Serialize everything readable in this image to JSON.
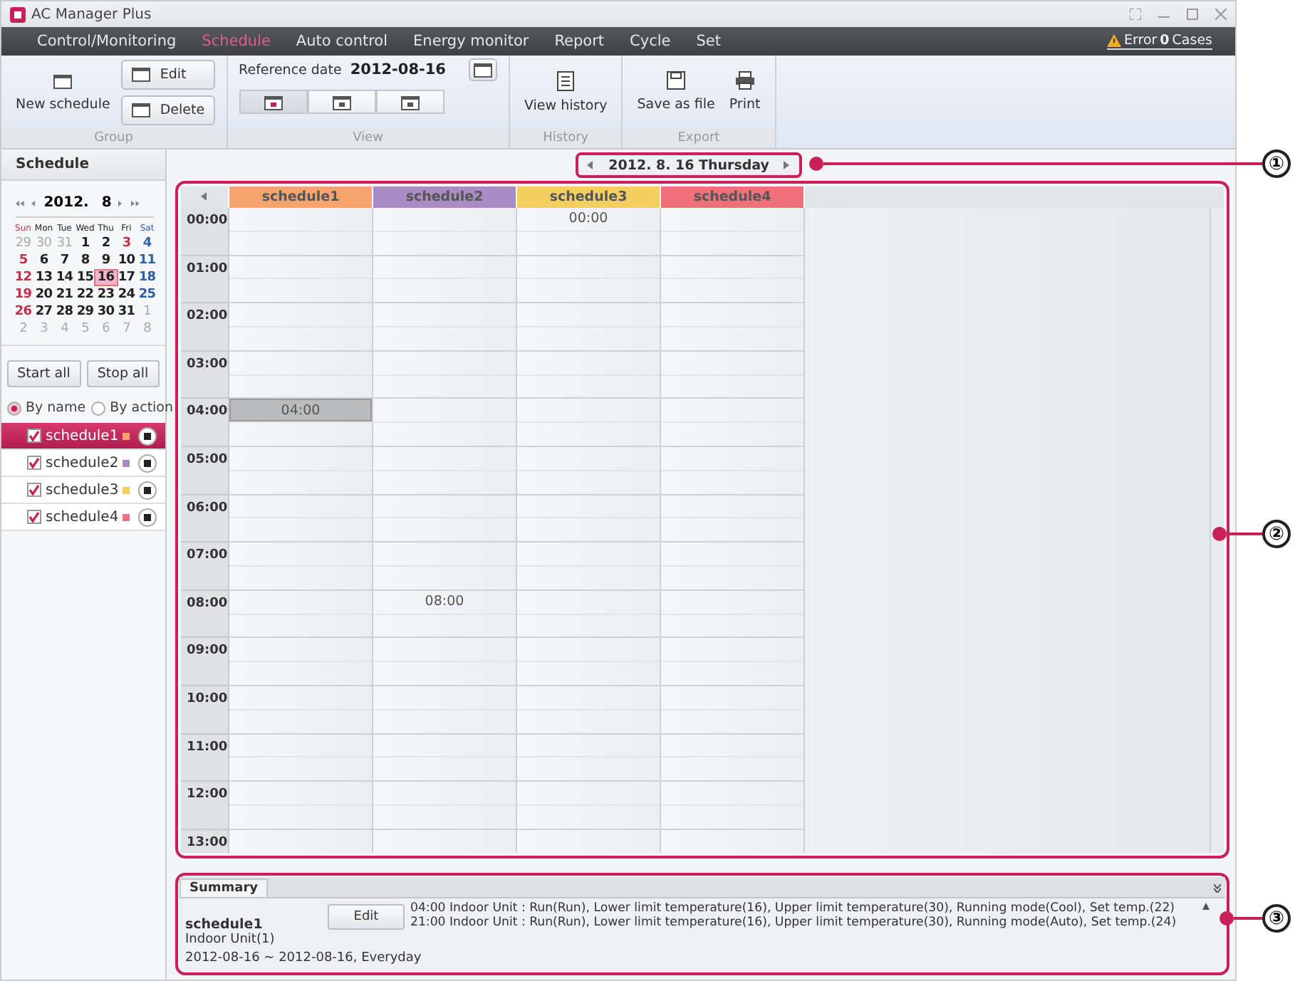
{
  "window": {
    "title": "AC Manager Plus"
  },
  "menu": [
    {
      "label": "Control/Monitoring",
      "selected": false
    },
    {
      "label": "Schedule",
      "selected": true
    },
    {
      "label": "Auto control",
      "selected": false
    },
    {
      "label": "Energy monitor",
      "selected": false
    },
    {
      "label": "Report",
      "selected": false
    },
    {
      "label": "Cycle",
      "selected": false
    },
    {
      "label": "Set",
      "selected": false
    }
  ],
  "error_status": {
    "label": "Error",
    "count": "0",
    "unit": "Cases"
  },
  "ribbon": {
    "group": {
      "new_label": "New schedule",
      "edit_label": "Edit",
      "delete_label": "Delete",
      "caption": "Group"
    },
    "view": {
      "reference_label": "Reference date",
      "reference_date": "2012-08-16",
      "caption": "View",
      "modes": [
        {
          "kind": "day",
          "selected": true
        },
        {
          "kind": "week",
          "selected": false
        },
        {
          "kind": "month",
          "selected": false
        }
      ]
    },
    "history": {
      "label": "View history",
      "caption": "History"
    },
    "export": {
      "save_label": "Save as file",
      "print_label": "Print",
      "caption": "Export"
    }
  },
  "sidebar": {
    "title": "Schedule",
    "calendar": {
      "year": "2012.",
      "month": "8",
      "weekdays": [
        {
          "label": "Sun",
          "kind": "sun"
        },
        {
          "label": "Mon",
          "kind": "normal"
        },
        {
          "label": "Tue",
          "kind": "normal"
        },
        {
          "label": "Wed",
          "kind": "normal"
        },
        {
          "label": "Thu",
          "kind": "normal"
        },
        {
          "label": "Fri",
          "kind": "normal"
        },
        {
          "label": "Sat",
          "kind": "sat"
        }
      ],
      "days": [
        {
          "label": "29",
          "kind": "other",
          "selected": false
        },
        {
          "label": "30",
          "kind": "other",
          "selected": false
        },
        {
          "label": "31",
          "kind": "other",
          "selected": false
        },
        {
          "label": "1",
          "kind": "normal",
          "selected": false
        },
        {
          "label": "2",
          "kind": "normal",
          "selected": false
        },
        {
          "label": "3",
          "kind": "sun",
          "selected": false
        },
        {
          "label": "4",
          "kind": "sat",
          "selected": false
        },
        {
          "label": "5",
          "kind": "sun",
          "selected": false
        },
        {
          "label": "6",
          "kind": "normal",
          "selected": false
        },
        {
          "label": "7",
          "kind": "normal",
          "selected": false
        },
        {
          "label": "8",
          "kind": "normal",
          "selected": false
        },
        {
          "label": "9",
          "kind": "normal",
          "selected": false
        },
        {
          "label": "10",
          "kind": "normal",
          "selected": false
        },
        {
          "label": "11",
          "kind": "sat",
          "selected": false
        },
        {
          "label": "12",
          "kind": "sun",
          "selected": false
        },
        {
          "label": "13",
          "kind": "normal",
          "selected": false
        },
        {
          "label": "14",
          "kind": "normal",
          "selected": false
        },
        {
          "label": "15",
          "kind": "normal",
          "selected": false
        },
        {
          "label": "16",
          "kind": "normal",
          "selected": true
        },
        {
          "label": "17",
          "kind": "normal",
          "selected": false
        },
        {
          "label": "18",
          "kind": "sat",
          "selected": false
        },
        {
          "label": "19",
          "kind": "sun",
          "selected": false
        },
        {
          "label": "20",
          "kind": "normal",
          "selected": false
        },
        {
          "label": "21",
          "kind": "normal",
          "selected": false
        },
        {
          "label": "22",
          "kind": "normal",
          "selected": false
        },
        {
          "label": "23",
          "kind": "normal",
          "selected": false
        },
        {
          "label": "24",
          "kind": "normal",
          "selected": false
        },
        {
          "label": "25",
          "kind": "sat",
          "selected": false
        },
        {
          "label": "26",
          "kind": "sun",
          "selected": false
        },
        {
          "label": "27",
          "kind": "normal",
          "selected": false
        },
        {
          "label": "28",
          "kind": "normal",
          "selected": false
        },
        {
          "label": "29",
          "kind": "normal",
          "selected": false
        },
        {
          "label": "30",
          "kind": "normal",
          "selected": false
        },
        {
          "label": "31",
          "kind": "normal",
          "selected": false
        },
        {
          "label": "1",
          "kind": "other",
          "selected": false
        },
        {
          "label": "2",
          "kind": "other",
          "selected": false
        },
        {
          "label": "3",
          "kind": "other",
          "selected": false
        },
        {
          "label": "4",
          "kind": "other",
          "selected": false
        },
        {
          "label": "5",
          "kind": "other",
          "selected": false
        },
        {
          "label": "6",
          "kind": "other",
          "selected": false
        },
        {
          "label": "7",
          "kind": "other",
          "selected": false
        },
        {
          "label": "8",
          "kind": "other",
          "selected": false
        }
      ]
    },
    "start_all": "Start all",
    "stop_all": "Stop all",
    "sort": [
      {
        "label": "By name",
        "selected": true
      },
      {
        "label": "By action",
        "selected": false
      }
    ],
    "schedules": [
      {
        "name": "schedule1",
        "color": "#f4a46c",
        "checked": true,
        "selected": true
      },
      {
        "name": "schedule2",
        "color": "#a98bc6",
        "checked": true,
        "selected": false
      },
      {
        "name": "schedule3",
        "color": "#f2cf5e",
        "checked": true,
        "selected": false
      },
      {
        "name": "schedule4",
        "color": "#ef6f7a",
        "checked": true,
        "selected": false
      }
    ]
  },
  "date_nav": {
    "label": "2012. 8. 16 Thursday"
  },
  "grid": {
    "columns": [
      {
        "name": "schedule1",
        "color": "#f4a46c"
      },
      {
        "name": "schedule2",
        "color": "#a98bc6"
      },
      {
        "name": "schedule3",
        "color": "#f2cf5e"
      },
      {
        "name": "schedule4",
        "color": "#ef6f7a"
      }
    ],
    "rows": [
      {
        "time": "00:00",
        "cells": [
          {},
          {},
          {
            "event": "00:00",
            "highlighted": false
          },
          {}
        ]
      },
      {
        "time": "01:00",
        "cells": [
          {},
          {},
          {},
          {}
        ]
      },
      {
        "time": "02:00",
        "cells": [
          {},
          {},
          {},
          {}
        ]
      },
      {
        "time": "03:00",
        "cells": [
          {},
          {},
          {},
          {}
        ]
      },
      {
        "time": "04:00",
        "cells": [
          {
            "event": "04:00",
            "highlighted": true
          },
          {},
          {},
          {}
        ]
      },
      {
        "time": "05:00",
        "cells": [
          {},
          {},
          {},
          {}
        ]
      },
      {
        "time": "06:00",
        "cells": [
          {},
          {},
          {},
          {}
        ]
      },
      {
        "time": "07:00",
        "cells": [
          {},
          {},
          {},
          {}
        ]
      },
      {
        "time": "08:00",
        "cells": [
          {},
          {
            "event": "08:00",
            "highlighted": false
          },
          {},
          {}
        ]
      },
      {
        "time": "09:00",
        "cells": [
          {},
          {},
          {},
          {}
        ]
      },
      {
        "time": "10:00",
        "cells": [
          {},
          {},
          {},
          {}
        ]
      },
      {
        "time": "11:00",
        "cells": [
          {},
          {},
          {},
          {}
        ]
      },
      {
        "time": "12:00",
        "cells": [
          {},
          {},
          {},
          {}
        ]
      },
      {
        "time": "13:00",
        "cells": [
          {},
          {},
          {},
          {}
        ]
      }
    ]
  },
  "summary": {
    "tab": "Summary",
    "name": "schedule1",
    "edit_label": "Edit",
    "unit": "Indoor Unit(1)",
    "period": "2012-08-16 ~ 2012-08-16, Everyday",
    "actions": [
      "04:00 Indoor Unit : Run(Run), Lower limit temperature(16), Upper limit temperature(30), Running mode(Cool), Set temp.(22)",
      "21:00 Indoor Unit : Run(Run), Lower limit temperature(16), Upper limit temperature(30), Running mode(Auto), Set temp.(24)"
    ]
  },
  "callouts": [
    "①",
    "②",
    "③"
  ]
}
